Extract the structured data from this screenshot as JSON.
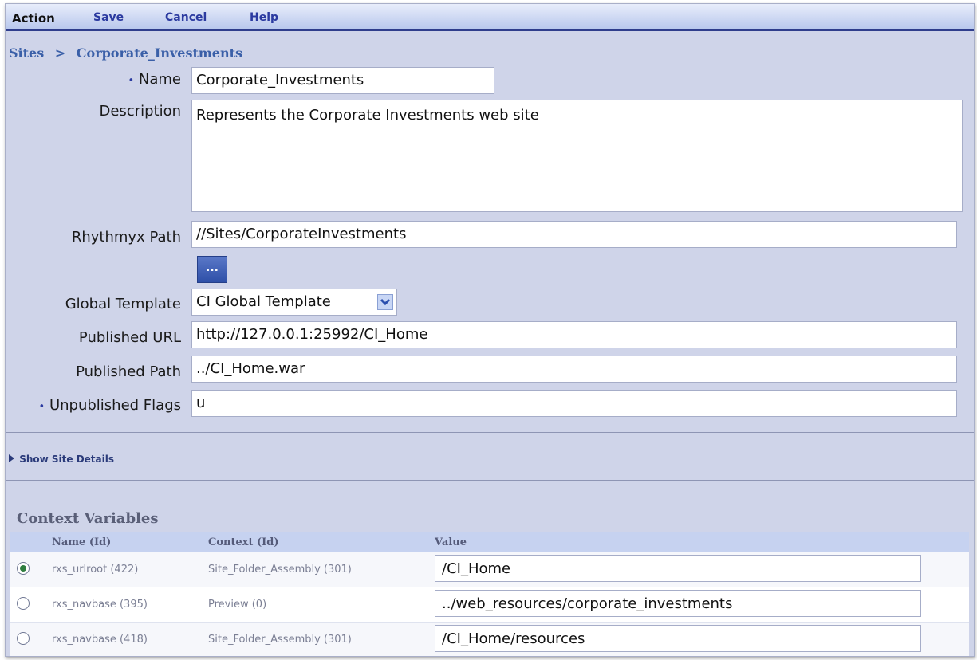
{
  "toolbar": {
    "action": "Action",
    "save": "Save",
    "cancel": "Cancel",
    "help": "Help"
  },
  "breadcrumb": {
    "root": "Sites",
    "separator": ">",
    "current": "Corporate_Investments"
  },
  "form": {
    "required_marker": "•",
    "name_label": "Name",
    "name_value": "Corporate_Investments",
    "description_label": "Description",
    "description_value": "Represents the Corporate Investments web site",
    "path_label": "Rhythmyx Path",
    "path_value": "//Sites/CorporateInvestments",
    "browse_label": "...",
    "template_label": "Global Template",
    "template_value": "CI Global Template",
    "url_label": "Published URL",
    "url_value": "http://127.0.0.1:25992/CI_Home",
    "pubpath_label": "Published Path",
    "pubpath_value": "../CI_Home.war",
    "flags_label": "Unpublished Flags",
    "flags_value": "u"
  },
  "site_details": {
    "toggle_icon": "triangle-right-icon",
    "label": "Show Site Details"
  },
  "context_variables": {
    "title": "Context Variables",
    "columns": [
      "Name (Id)",
      "Context (Id)",
      "Value"
    ],
    "rows": [
      {
        "selected": true,
        "name": "rxs_urlroot (422)",
        "context": "Site_Folder_Assembly (301)",
        "value": "/CI_Home"
      },
      {
        "selected": false,
        "name": "rxs_navbase (395)",
        "context": "Preview (0)",
        "value": "../web_resources/corporate_investments"
      },
      {
        "selected": false,
        "name": "rxs_navbase (418)",
        "context": "Site_Folder_Assembly (301)",
        "value": "/CI_Home/resources"
      }
    ]
  }
}
